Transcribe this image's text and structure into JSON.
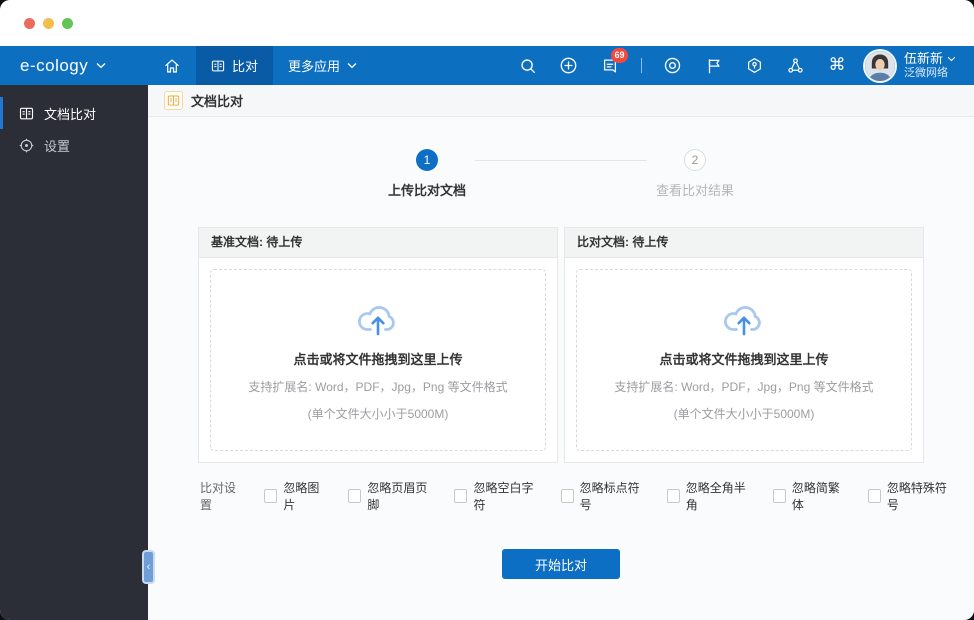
{
  "titlebar": {
    "dot_colors": {
      "close": "#ec6a5e",
      "minimize": "#f4bd4f",
      "maximize": "#61c454"
    }
  },
  "appbar": {
    "logo": "e-cology",
    "home_icon": "home-icon",
    "tabs": [
      {
        "label": "比对",
        "icon": "compare-icon",
        "active": true
      },
      {
        "label": "更多应用",
        "icon": "chevron-down-icon",
        "active": false
      }
    ],
    "badge_count": "69",
    "user": {
      "name": "伍新新",
      "org": "泛微网络"
    }
  },
  "icons": {
    "command": "⌘",
    "collapse": "‹"
  },
  "sidebar": {
    "items": [
      {
        "label": "文档比对",
        "icon": "compare-icon",
        "active": true
      },
      {
        "label": "设置",
        "icon": "gear-icon",
        "active": false
      }
    ]
  },
  "breadcrumb": {
    "title": "文档比对"
  },
  "steps": [
    {
      "num": "1",
      "label": "上传比对文档",
      "active": true
    },
    {
      "num": "2",
      "label": "查看比对结果",
      "active": false
    }
  ],
  "panels": [
    {
      "title": "基准文档: 待上传"
    },
    {
      "title": "比对文档: 待上传"
    }
  ],
  "upload": {
    "main": "点击或将文件拖拽到这里上传",
    "formats": "支持扩展名: Word，PDF，Jpg，Png 等文件格式",
    "size_limit": "(单个文件大小小于5000M)"
  },
  "compare_settings": {
    "label": "比对设置",
    "options": [
      "忽略图片",
      "忽略页眉页脚",
      "忽略空白字符",
      "忽略标点符号",
      "忽略全角半角",
      "忽略简繁体",
      "忽略特殊符号"
    ]
  },
  "actions": {
    "start": "开始比对"
  },
  "colors": {
    "header_blue": "#0d6fc0",
    "active_tab_blue": "#0a5ba6",
    "primary_blue": "#0d6fc4",
    "sidebar_bg": "#2b2e37",
    "badge_red": "#f5483d",
    "accent_orange": "#e8a845",
    "cloud_light_blue": "#a9c8ef",
    "cloud_arrow_blue": "#4a90e2"
  }
}
